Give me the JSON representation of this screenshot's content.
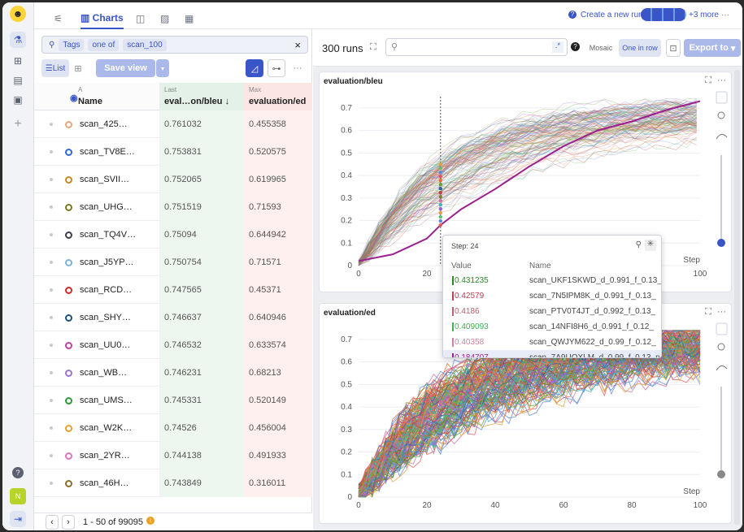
{
  "topbar": {
    "tabs": [
      "Charts"
    ],
    "create_run": "Create a new run",
    "more_users": "+3 more",
    "more": "···"
  },
  "filter": {
    "tags_label": "Tags",
    "op": "one of",
    "value": "scan_100",
    "close": "×"
  },
  "toolbar": {
    "list": "List",
    "save_view": "Save view",
    "more": "···"
  },
  "columns": {
    "last_badge": "Last",
    "max_badge": "Max",
    "name": "Name",
    "col1": "eval…on/bleu",
    "col1_sort": "↓",
    "col2": "evaluation/ed"
  },
  "rows": [
    {
      "name": "scan_425…",
      "v1": "0.761032",
      "v2": "0.455358",
      "color": "#e8a87c"
    },
    {
      "name": "scan_TV8E…",
      "v1": "0.753831",
      "v2": "0.520575",
      "color": "#2d6bd6"
    },
    {
      "name": "scan_SVII…",
      "v1": "0.752065",
      "v2": "0.619965",
      "color": "#c48a1a"
    },
    {
      "name": "scan_UHG…",
      "v1": "0.751519",
      "v2": "0.71593",
      "color": "#7a7a20"
    },
    {
      "name": "scan_TQ4V…",
      "v1": "0.75094",
      "v2": "0.644942",
      "color": "#3a3f4a"
    },
    {
      "name": "scan_J5YP…",
      "v1": "0.750754",
      "v2": "0.71571",
      "color": "#7fb0d8"
    },
    {
      "name": "scan_RCD…",
      "v1": "0.747565",
      "v2": "0.45371",
      "color": "#d22a2a"
    },
    {
      "name": "scan_SHY…",
      "v1": "0.746637",
      "v2": "0.640946",
      "color": "#1f4f7a"
    },
    {
      "name": "scan_UU0…",
      "v1": "0.746532",
      "v2": "0.633574",
      "color": "#c440a0"
    },
    {
      "name": "scan_WB…",
      "v1": "0.746231",
      "v2": "0.68213",
      "color": "#a070d8"
    },
    {
      "name": "scan_UMS…",
      "v1": "0.745331",
      "v2": "0.520149",
      "color": "#2a9a3a"
    },
    {
      "name": "scan_W2K…",
      "v1": "0.74526",
      "v2": "0.456004",
      "color": "#e8a030"
    },
    {
      "name": "scan_2YR…",
      "v1": "0.744138",
      "v2": "0.491933",
      "color": "#e870c0"
    },
    {
      "name": "scan_46H…",
      "v1": "0.743849",
      "v2": "0.316011",
      "color": "#8a7020"
    }
  ],
  "pager": {
    "range": "1 - 50 of 99095"
  },
  "runs": {
    "count": "300 runs",
    "mosaic": "Mosaic",
    "one_in_row": "One in row",
    "export": "Export to"
  },
  "panels": [
    {
      "title": "evaluation/bleu"
    },
    {
      "title": "evaluation/ed"
    }
  ],
  "axes": {
    "y": [
      "0",
      "0.1",
      "0.2",
      "0.3",
      "0.4",
      "0.5",
      "0.6",
      "0.7"
    ],
    "x": [
      "0",
      "20",
      "40",
      "60",
      "80",
      "100"
    ],
    "xlabel": "Step"
  },
  "tooltip": {
    "step": "Step: 24",
    "value_h": "Value",
    "name_h": "Name",
    "rows": [
      {
        "v": "0.431235",
        "n": "scan_UKF1SKWD_d_0.991_f_0.13_",
        "c": "#2a8a2a"
      },
      {
        "v": "0.42579",
        "n": "scan_7N5IPM8K_d_0.991_f_0.13_",
        "c": "#c04050"
      },
      {
        "v": "0.4186",
        "n": "scan_PTV0T4JT_d_0.992_f_0.13_",
        "c": "#c06070"
      },
      {
        "v": "0.409093",
        "n": "scan_14NFI8H6_d_0.991_f_0.12_",
        "c": "#40b050"
      },
      {
        "v": "0.40358",
        "n": "scan_QWJYM622_d_0.99_f_0.12_",
        "c": "#d080a0"
      },
      {
        "v": "0.184707",
        "n": "scan_7A9UOXLM_d_0.99_f_0.13_n_",
        "c": "#9a2090"
      }
    ]
  },
  "chart_data": [
    {
      "type": "line",
      "title": "evaluation/bleu",
      "xlabel": "Step",
      "xlim": [
        0,
        100
      ],
      "ylim": [
        0,
        0.75
      ],
      "series": [
        {
          "name": "scan_7A9UOXLM_d_0.99_f_0.13_n_",
          "x": [
            0,
            10,
            20,
            24,
            30,
            40,
            50,
            60,
            70,
            80,
            90,
            100
          ],
          "values": [
            0.02,
            0.05,
            0.12,
            0.18,
            0.25,
            0.34,
            0.44,
            0.53,
            0.6,
            0.64,
            0.69,
            0.73
          ]
        }
      ]
    },
    {
      "type": "line",
      "title": "evaluation/ed",
      "xlabel": "Step",
      "xlim": [
        0,
        100
      ],
      "ylim": [
        0,
        0.75
      ],
      "series": []
    }
  ]
}
